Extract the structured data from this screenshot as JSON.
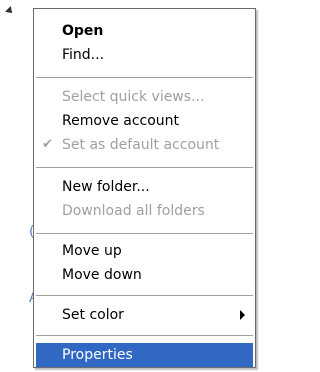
{
  "menu": {
    "items": [
      {
        "label": "Open"
      },
      {
        "label": "Find..."
      },
      {
        "label": "Select quick views..."
      },
      {
        "label": "Remove account"
      },
      {
        "label": "Set as default account",
        "checked": true
      },
      {
        "label": "New folder..."
      },
      {
        "label": "Download all folders"
      },
      {
        "label": "Move up"
      },
      {
        "label": "Move down"
      },
      {
        "label": "Set color",
        "has_submenu": true
      },
      {
        "label": "Properties",
        "highlighted": true
      }
    ],
    "check_glyph": "✔"
  },
  "colors": {
    "highlight": "#3168c4",
    "disabled_text": "#a0a0a0",
    "separator": "#a0a0a0",
    "background_link": "#5a7fc4"
  }
}
